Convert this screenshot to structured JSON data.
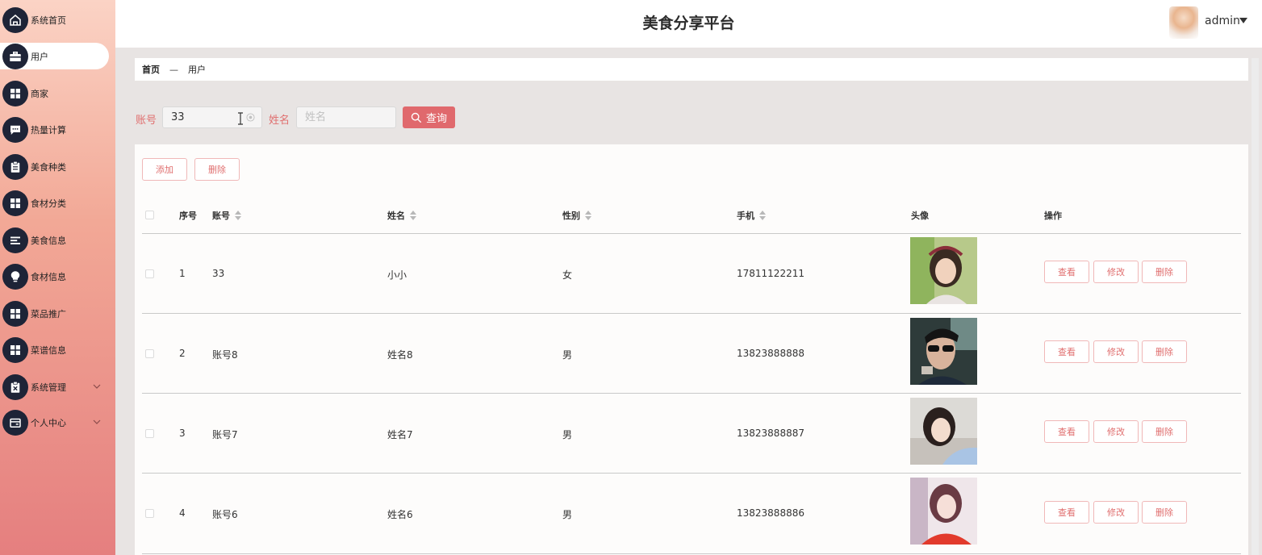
{
  "header": {
    "title": "美食分享平台",
    "user": "admin"
  },
  "sidebar": {
    "items": [
      {
        "label": "系统首页",
        "icon": "home-icon"
      },
      {
        "label": "用户",
        "icon": "briefcase-icon",
        "active": true
      },
      {
        "label": "商家",
        "icon": "grid-icon"
      },
      {
        "label": "热量计算",
        "icon": "chat-icon"
      },
      {
        "label": "美食种类",
        "icon": "clipboard-icon"
      },
      {
        "label": "食材分类",
        "icon": "grid-icon"
      },
      {
        "label": "美食信息",
        "icon": "list-icon"
      },
      {
        "label": "食材信息",
        "icon": "bulb-icon"
      },
      {
        "label": "菜品推广",
        "icon": "grid-icon"
      },
      {
        "label": "菜谱信息",
        "icon": "grid-icon"
      },
      {
        "label": "系统管理",
        "icon": "clipboard-x-icon",
        "expandable": true
      },
      {
        "label": "个人中心",
        "icon": "wallet-icon",
        "expandable": true
      }
    ]
  },
  "breadcrumb": {
    "home": "首页",
    "separator": "—",
    "current": "用户"
  },
  "search": {
    "account_label": "账号",
    "account_value": "33",
    "name_label": "姓名",
    "name_placeholder": "姓名",
    "query_button": "查询"
  },
  "toolbar": {
    "add": "添加",
    "delete": "删除"
  },
  "table": {
    "headers": {
      "index": "序号",
      "account": "账号",
      "name": "姓名",
      "gender": "性别",
      "phone": "手机",
      "avatar": "头像",
      "actions": "操作"
    },
    "rows": [
      {
        "index": "1",
        "account": "33",
        "name": "小小",
        "gender": "女",
        "phone": "17811122211"
      },
      {
        "index": "2",
        "account": "账号8",
        "name": "姓名8",
        "gender": "男",
        "phone": "13823888888"
      },
      {
        "index": "3",
        "account": "账号7",
        "name": "姓名7",
        "gender": "男",
        "phone": "13823888887"
      },
      {
        "index": "4",
        "account": "账号6",
        "name": "姓名6",
        "gender": "男",
        "phone": "13823888886"
      }
    ],
    "row_actions": {
      "view": "查看",
      "edit": "修改",
      "delete": "删除"
    }
  },
  "colors": {
    "accent": "#e0696d",
    "sidebar_icon_bg": "#1e2437",
    "border_pink": "#f0b8b8"
  }
}
